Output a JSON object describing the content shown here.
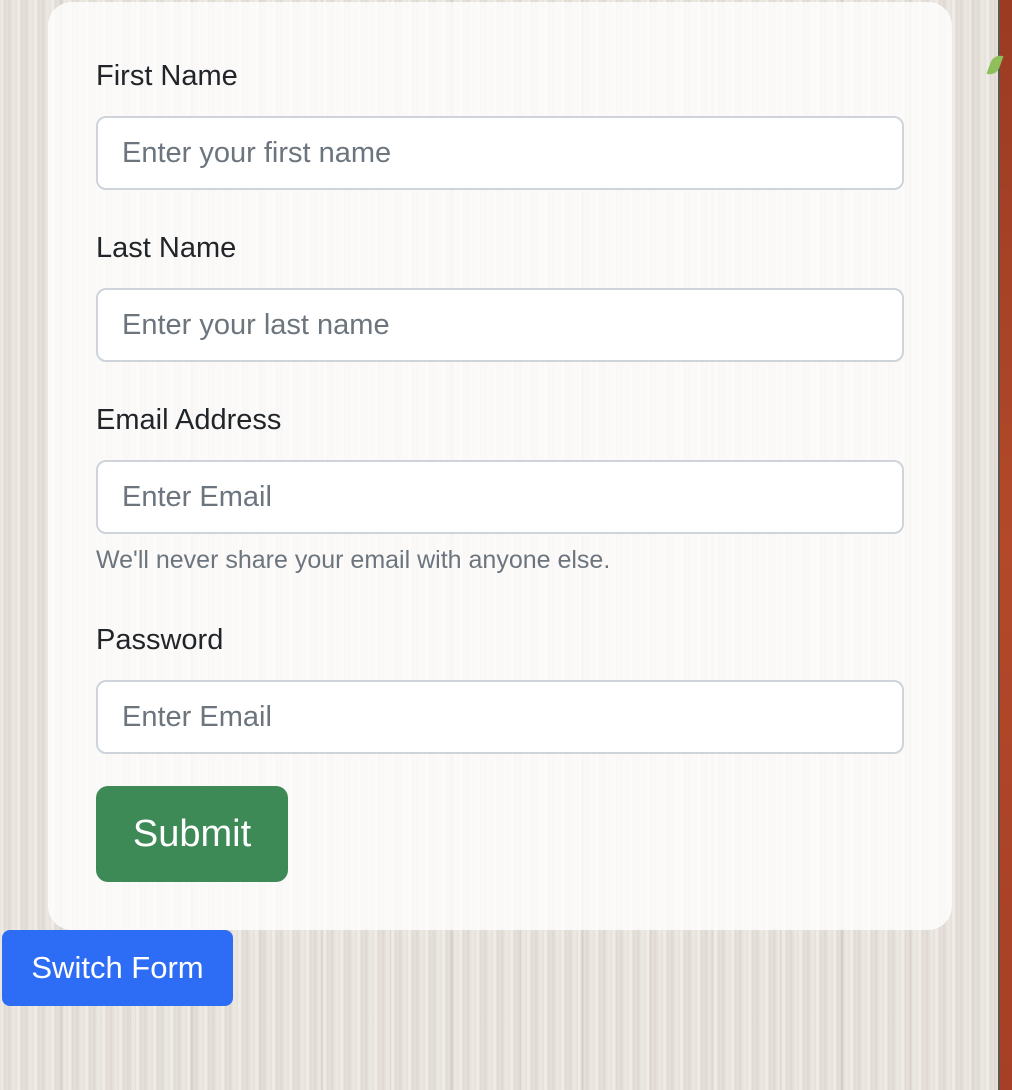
{
  "form": {
    "first_name": {
      "label": "First Name",
      "placeholder": "Enter your first name",
      "value": ""
    },
    "last_name": {
      "label": "Last Name",
      "placeholder": "Enter your last name",
      "value": ""
    },
    "email": {
      "label": "Email Address",
      "placeholder": "Enter Email",
      "value": "",
      "help": "We'll never share your email with anyone else."
    },
    "password": {
      "label": "Password",
      "placeholder": "Enter Email",
      "value": ""
    },
    "submit_label": "Submit"
  },
  "switch_form_label": "Switch Form",
  "colors": {
    "submit": "#3d8a57",
    "switch": "#2d6df6",
    "placeholder": "#6c757d",
    "label": "#212529"
  }
}
